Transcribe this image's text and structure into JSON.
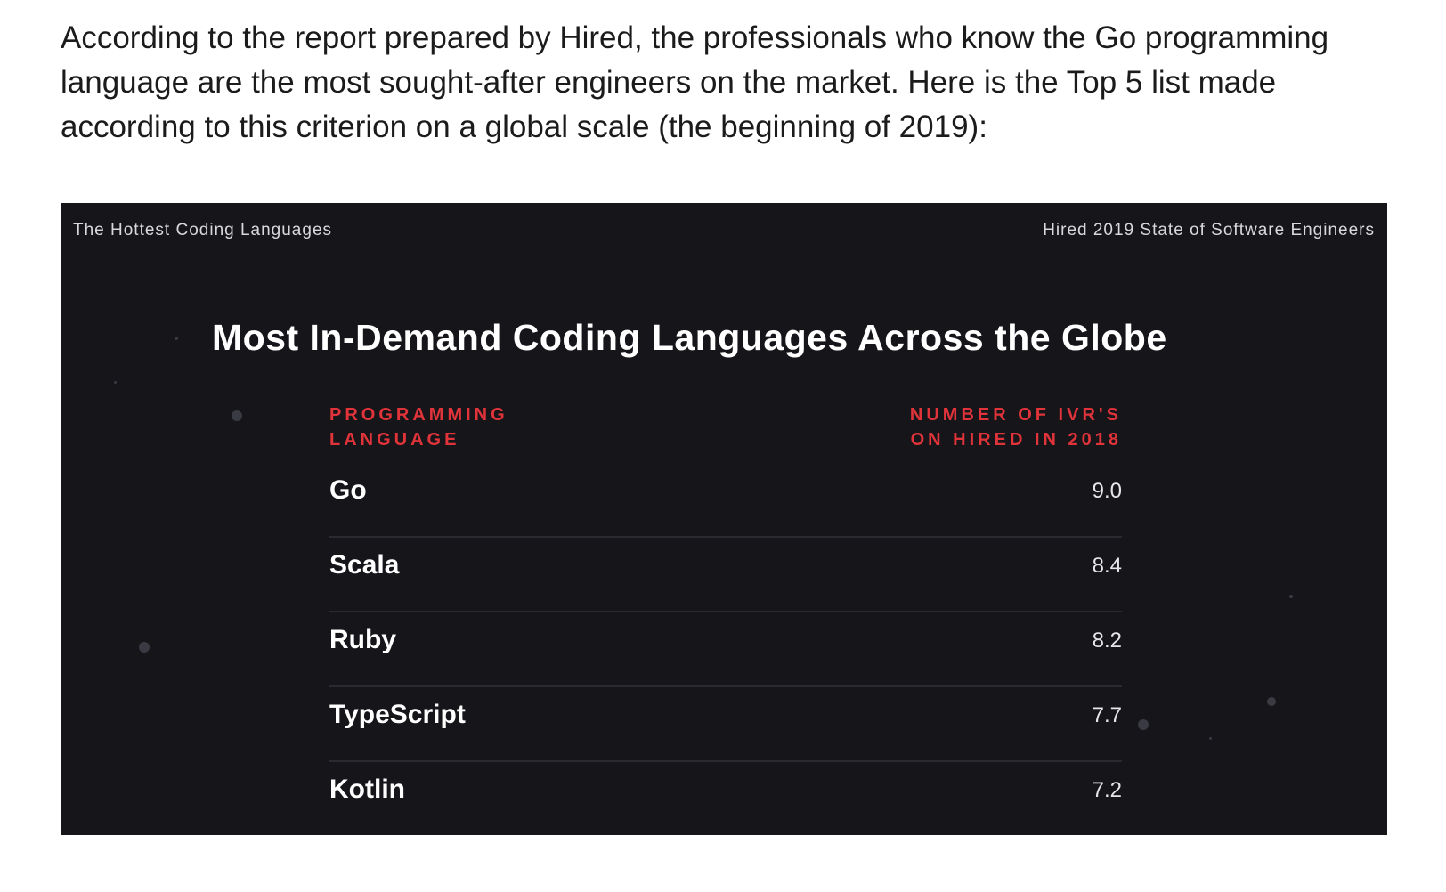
{
  "intro": {
    "line1": "According to the report prepared by Hired, the professionals who know the Go programming",
    "line2": "language are the most sought-after engineers on the market. Here is the Top 5 list made",
    "line3": "according to this criterion on a global scale (the beginning of 2019):"
  },
  "infographic": {
    "top_left_label": "The Hottest Coding Languages",
    "top_right_label": "Hired 2019 State of Software Engineers",
    "title": "Most In-Demand Coding Languages Across the Globe",
    "col_left": [
      "PROGRAMMING",
      "LANGUAGE"
    ],
    "col_right": [
      "NUMBER OF IVR'S",
      "ON HIRED IN 2018"
    ],
    "accent_color": "#e0343a",
    "background_color": "#16151a",
    "rows": [
      {
        "language": "Go",
        "value": "9.0"
      },
      {
        "language": "Scala",
        "value": "8.4"
      },
      {
        "language": "Ruby",
        "value": "8.2"
      },
      {
        "language": "TypeScript",
        "value": "7.7"
      },
      {
        "language": "Kotlin",
        "value": "7.2"
      }
    ]
  }
}
